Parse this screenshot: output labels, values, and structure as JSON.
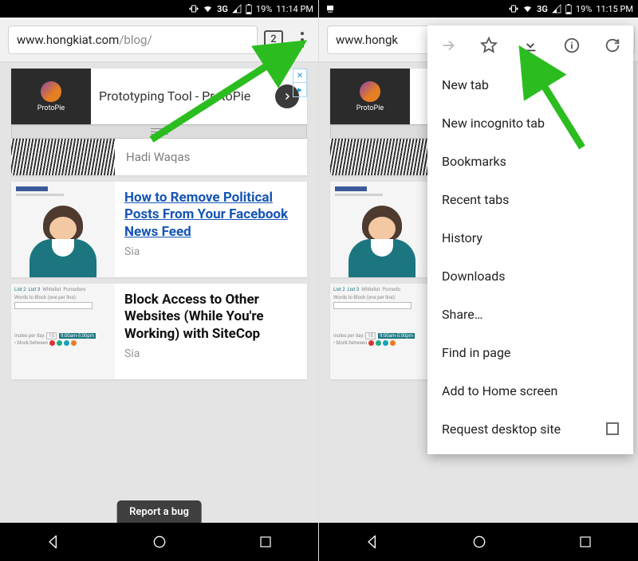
{
  "status_left": {
    "network": "3G",
    "battery_pct": "19%",
    "time": "11:14 PM"
  },
  "status_right": {
    "network": "3G",
    "battery_pct": "19%",
    "time": "11:15 PM"
  },
  "left": {
    "url_main": "www.hongkiat.com",
    "url_path": "/blog/",
    "tab_count": "2",
    "ad": {
      "logo_label": "ProtoPie",
      "text": "Prototyping Tool - ProtoPie"
    },
    "author_strip": "Hadi Waqas",
    "articles": [
      {
        "title": "How to Remove Political Posts From Your Facebook News Feed",
        "author": "Sia",
        "is_link": true
      },
      {
        "title": "Block Access to Other Websites (While You're Working) with SiteCop",
        "author": "Sia",
        "is_link": false
      }
    ],
    "report_bug": "Report a bug"
  },
  "right": {
    "url_visible": "www.hongk",
    "menu_items": [
      "New tab",
      "New incognito tab",
      "Bookmarks",
      "Recent tabs",
      "History",
      "Downloads",
      "Share…",
      "Find in page",
      "Add to Home screen"
    ],
    "menu_checkbox_item": "Request desktop site"
  }
}
